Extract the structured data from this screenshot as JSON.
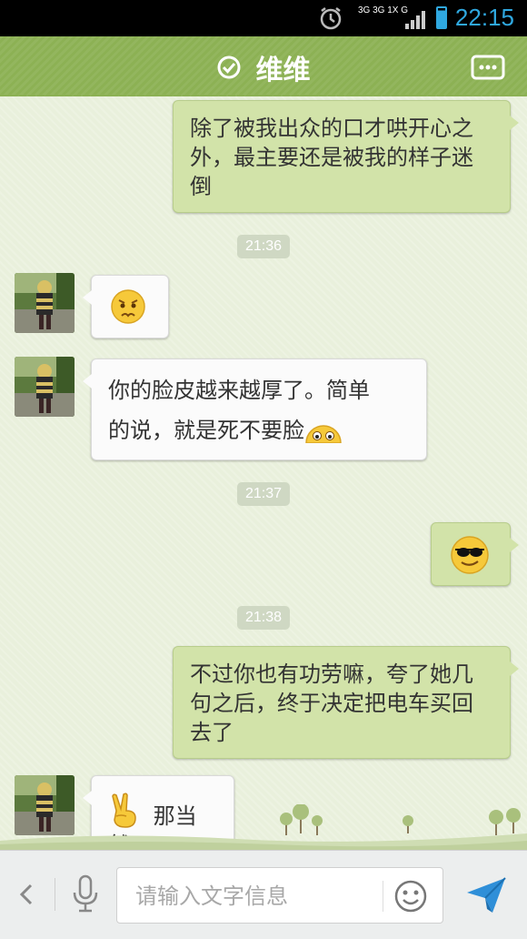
{
  "status_bar": {
    "time": "22:15",
    "network": "3G 3G 1X G",
    "accent_color": "#2fa8e0"
  },
  "header": {
    "title": "维维",
    "verified_icon": "check-circle-icon",
    "menu_icon": "more-options-icon",
    "bar_color": "#8cb154"
  },
  "messages": [
    {
      "side": "out",
      "text": "除了被我出众的口才哄开心之外，最主要还是被我的样子迷倒"
    },
    {
      "type": "timestamp",
      "text": "21:36"
    },
    {
      "side": "in",
      "emoji": "worried-face-emoji"
    },
    {
      "side": "in",
      "text_line1": "你的脸皮越来越厚了。简单",
      "text_line2": "的说，就是死不要脸",
      "emoji": "peeking-face-emoji"
    },
    {
      "type": "timestamp",
      "text": "21:37"
    },
    {
      "side": "out",
      "emoji": "sunglasses-face-emoji"
    },
    {
      "type": "timestamp",
      "text": "21:38"
    },
    {
      "side": "out",
      "text": "不过你也有功劳嘛，夸了她几句之后，终于决定把电车买回去了"
    },
    {
      "side": "in",
      "emoji": "victory-hand-emoji",
      "text": "那当然"
    }
  ],
  "input_bar": {
    "placeholder": "请输入文字信息",
    "back_icon": "chevron-left-icon",
    "voice_icon": "microphone-icon",
    "emoji_icon": "smiley-icon",
    "send_icon": "send-icon"
  },
  "colors": {
    "outgoing_bubble": "#d2e3a9",
    "incoming_bubble": "#fbfbfb",
    "chat_background": "#e9f0dc"
  }
}
